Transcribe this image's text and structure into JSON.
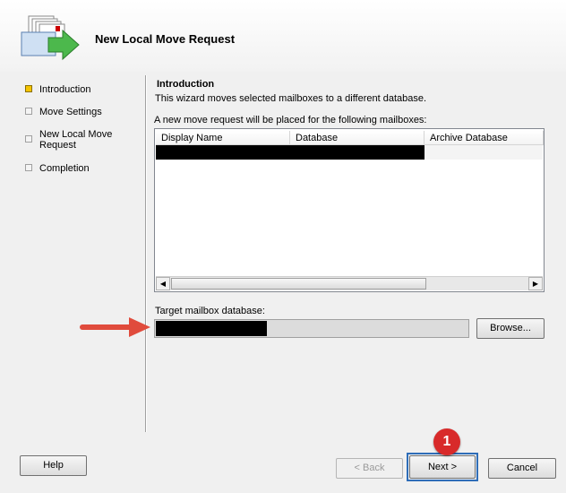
{
  "window": {
    "title": "New Local Move Request"
  },
  "sidebar": {
    "items": [
      {
        "label": "Introduction",
        "active": true
      },
      {
        "label": "Move Settings",
        "active": false
      },
      {
        "label": "New Local Move Request",
        "active": false
      },
      {
        "label": "Completion",
        "active": false
      }
    ]
  },
  "intro": {
    "title": "Introduction",
    "description": "This wizard moves selected mailboxes to a different database.",
    "list_label": "A new move request will be placed for the following mailboxes:"
  },
  "mailbox_table": {
    "columns": [
      "Display Name",
      "Database",
      "Archive Database"
    ],
    "rows": [
      {
        "redacted": true
      }
    ]
  },
  "target": {
    "label": "Target mailbox database:",
    "value_redacted": true
  },
  "buttons": {
    "browse": "Browse...",
    "help": "Help",
    "back": "< Back",
    "next": "Next >",
    "cancel": "Cancel"
  },
  "annotations": {
    "step_badge": "1",
    "accent_color": "#d82a2a",
    "highlight_color": "#2e6db8"
  }
}
